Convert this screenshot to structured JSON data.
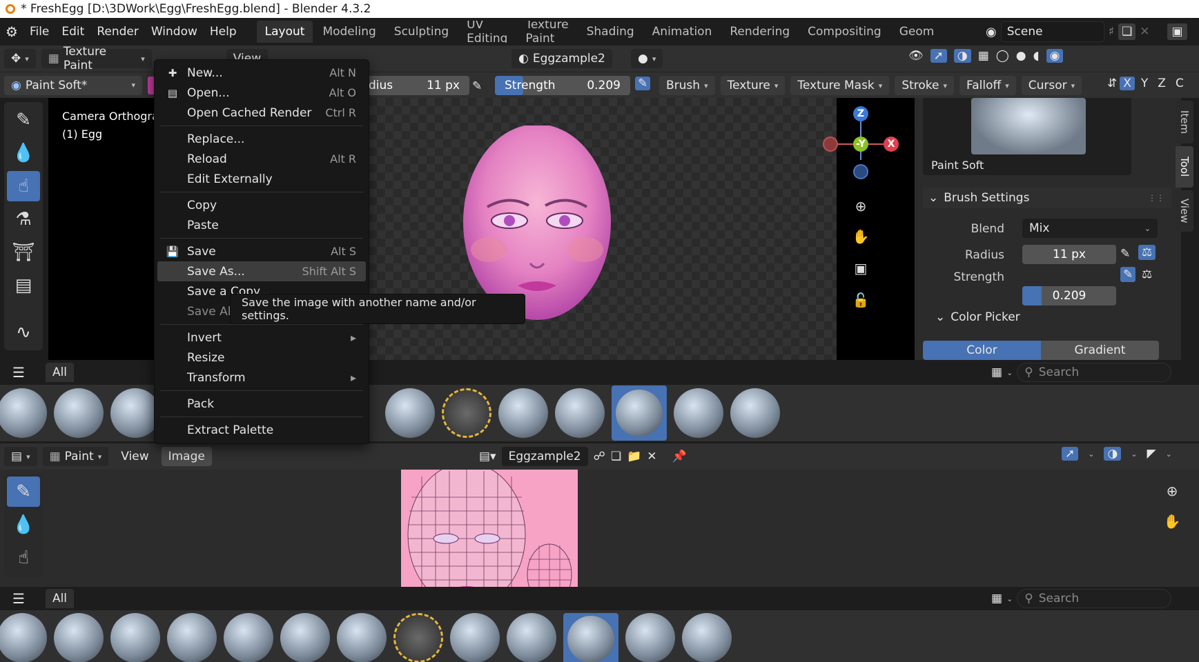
{
  "window": {
    "title": "* FreshEgg [D:\\3DWork\\Egg\\FreshEgg.blend] - Blender 4.3.2"
  },
  "menubar": {
    "items": [
      "File",
      "Edit",
      "Render",
      "Window",
      "Help"
    ],
    "workspaces": [
      "Layout",
      "Modeling",
      "Sculpting",
      "UV Editing",
      "Texture Paint",
      "Shading",
      "Animation",
      "Rendering",
      "Compositing",
      "Geome"
    ],
    "active_workspace": "Layout",
    "scene": "Scene"
  },
  "viewport_header": {
    "mode": "Texture Paint",
    "view_menu": "View",
    "image_name": "Eggzample2",
    "brush_name": "Paint Soft*",
    "radius_label": "dius",
    "radius_value": "11 px",
    "strength_label": "Strength",
    "strength_value": "0.209",
    "strength_fraction": 0.209,
    "menus": [
      "Brush",
      "Texture",
      "Texture Mask",
      "Stroke",
      "Falloff",
      "Cursor"
    ],
    "axes": [
      "X",
      "Y",
      "Z"
    ],
    "tail": "C"
  },
  "viewport": {
    "camera_label": "Camera Orthogra",
    "object_label": "(1) Egg",
    "gizmo": {
      "z": "Z",
      "y": "-Y",
      "x": "X"
    }
  },
  "file_menu": {
    "items": [
      {
        "label": "New...",
        "shortcut": "Alt N",
        "icon": "new-image-icon"
      },
      {
        "label": "Open...",
        "shortcut": "Alt O",
        "icon": "folder-icon"
      },
      {
        "label": "Open Cached Render",
        "shortcut": "Ctrl R"
      },
      {
        "label": "Replace...",
        "shortcut": ""
      },
      {
        "label": "Reload",
        "shortcut": "Alt R"
      },
      {
        "label": "Edit Externally",
        "shortcut": ""
      },
      {
        "label": "Copy",
        "shortcut": ""
      },
      {
        "label": "Paste",
        "shortcut": ""
      },
      {
        "label": "Save",
        "shortcut": "Alt S",
        "icon": "save-icon"
      },
      {
        "label": "Save As...",
        "shortcut": "Shift Alt S"
      },
      {
        "label": "Save a Copy...",
        "shortcut": ""
      },
      {
        "label": "Save All",
        "shortcut": ""
      },
      {
        "label": "Invert",
        "shortcut": ""
      },
      {
        "label": "Resize",
        "shortcut": ""
      },
      {
        "label": "Transform",
        "shortcut": ""
      },
      {
        "label": "Pack",
        "shortcut": ""
      },
      {
        "label": "Extract Palette",
        "shortcut": ""
      }
    ],
    "tooltip": "Save the image with another name and/or settings."
  },
  "side_panel": {
    "tabs": [
      "Item",
      "Tool",
      "View"
    ],
    "brush_preview_label": "Paint Soft",
    "brush_settings_title": "Brush Settings",
    "blend_label": "Blend",
    "blend_value": "Mix",
    "radius_label": "Radius",
    "radius_value": "11 px",
    "strength_label": "Strength",
    "strength_value": "0.209",
    "color_picker_title": "Color Picker",
    "color_tab": "Color",
    "gradient_tab": "Gradient"
  },
  "asset_shelf": {
    "tab": "All",
    "search_placeholder": "Search"
  },
  "image_editor": {
    "mode": "Paint",
    "menus": [
      "View",
      "Image"
    ],
    "image_name": "Eggzample2"
  },
  "bottom_shelf": {
    "tab": "All",
    "search_placeholder": "Search"
  },
  "colors": {
    "accent": "#4772b3",
    "brush_pink": "#c33a9e",
    "header": "#303030",
    "background": "#1d1d1d"
  }
}
